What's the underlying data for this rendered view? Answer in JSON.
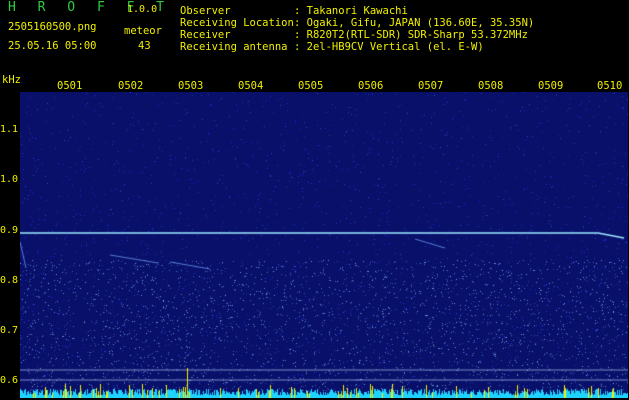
{
  "header": {
    "app_title": "H R O F F T",
    "version": "1.0.0",
    "filename": "2505160500.png",
    "meteor_label": "meteor",
    "datetime": "25.05.16 05:00",
    "meteor_count": "43"
  },
  "info": [
    {
      "key": "Observer",
      "value": ": Takanori Kawachi"
    },
    {
      "key": "Receiving Location",
      "value": ": Ogaki, Gifu, JAPAN (136.60E, 35.35N)"
    },
    {
      "key": "Receiver",
      "value": ": R820T2(RTL-SDR) SDR-Sharp 53.372MHz"
    },
    {
      "key": "Receiving antenna",
      "value": ": 2el-HB9CV Vertical (el. E-W)"
    }
  ],
  "axes": {
    "y_unit": "kHz",
    "y_ticks": [
      "1.1",
      "1.0",
      "0.9",
      "0.8",
      "0.7",
      "0.6"
    ],
    "x_ticks": [
      "0501",
      "0502",
      "0503",
      "0504",
      "0505",
      "0506",
      "0507",
      "0508",
      "0509",
      "0510"
    ]
  },
  "colors": {
    "background": "#000000",
    "label": "#f0f000",
    "title": "#2ecc40",
    "spectrogram_base": "#08106a",
    "carrier": "#9fe8ff",
    "noise_floor": "#1ed3ff"
  }
}
